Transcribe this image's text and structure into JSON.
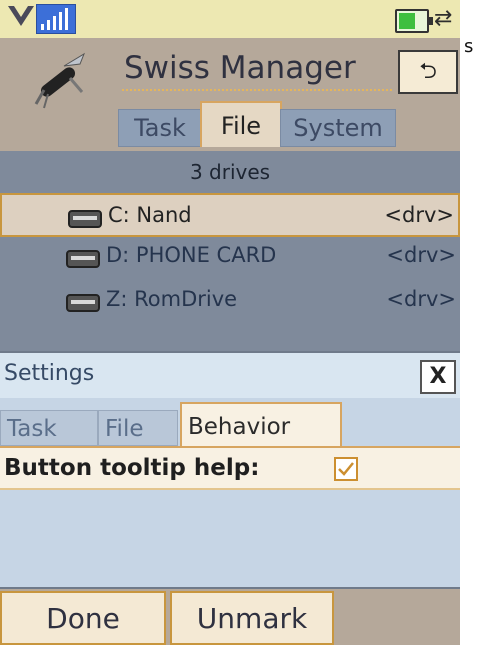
{
  "side_text": "s",
  "status_bar": {
    "icons": [
      "notification-arrow-icon",
      "signal-strength-icon",
      "battery-icon",
      "sync-icon"
    ]
  },
  "app": {
    "title": "Swiss Manager",
    "logo": "swiss-knife-icon",
    "back_glyph": "⮌",
    "tabs": [
      {
        "label": "Task",
        "active": false
      },
      {
        "label": "File",
        "active": true
      },
      {
        "label": "System",
        "active": false
      }
    ]
  },
  "drives": {
    "count_label": "3 drives",
    "items": [
      {
        "name": "C: Nand",
        "tag": "<drv>",
        "selected": true
      },
      {
        "name": "D: PHONE CARD",
        "tag": "<drv>",
        "selected": false
      },
      {
        "name": "Z: RomDrive",
        "tag": "<drv>",
        "selected": false
      }
    ]
  },
  "dialog": {
    "title": "Settings",
    "close_label": "X",
    "tabs": [
      {
        "label": "Task",
        "active": false
      },
      {
        "label": "File",
        "active": false
      },
      {
        "label": "Behavior",
        "active": true
      }
    ],
    "option": {
      "label": "Button tooltip help:",
      "checked": true
    }
  },
  "softkeys": {
    "left": "Done",
    "right": "Unmark"
  },
  "colors": {
    "status_bar_bg": "#ede8b2",
    "header_bg": "#b5a89a",
    "drive_panel_bg": "#7f8a9b",
    "dialog_bg": "#c6d5e5",
    "accent_border": "#d7a560"
  }
}
